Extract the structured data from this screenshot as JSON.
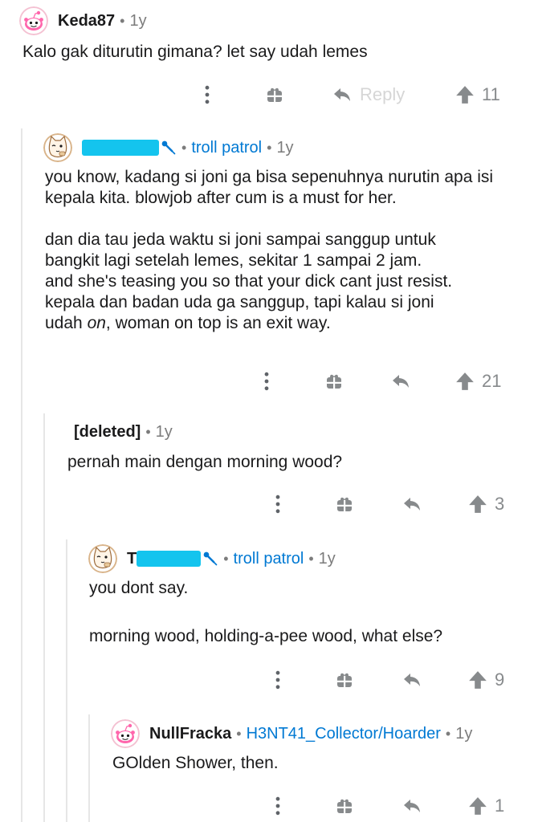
{
  "comments": [
    {
      "username": "Keda87",
      "age": "1y",
      "body": [
        "Kalo gak diturutin gimana? let say udah lemes"
      ],
      "reply_label": "Reply",
      "votes": "11"
    },
    {
      "username_suffix": "",
      "flair": "troll patrol",
      "age": "1y",
      "body_p1": "you know, kadang si joni ga bisa sepenuhnya nurutin apa isi kepala kita. blowjob after cum is a must for her.",
      "body_p2_lines": [
        "dan dia tau jeda waktu si joni sampai sanggup untuk",
        "bangkit lagi setelah lemes, sekitar 1 sampai 2 jam.",
        "and she's teasing you so that your dick cant just resist.",
        "kepala dan badan uda ga sanggup, tapi kalau si joni"
      ],
      "body_p2_last_a": "udah ",
      "body_p2_last_em": "on",
      "body_p2_last_b": ", woman on top is an exit way.",
      "votes": "21"
    },
    {
      "username": "[deleted]",
      "age": "1y",
      "body": [
        "pernah main dengan morning wood?"
      ],
      "votes": "3"
    },
    {
      "username_prefix": "T",
      "flair": "troll patrol",
      "age": "1y",
      "body": [
        "you dont say.",
        "morning wood, holding-a-pee wood, what else?"
      ],
      "votes": "9"
    },
    {
      "username": "NullFracka",
      "flair": "H3NT41_Collector/Hoarder",
      "age": "1y",
      "body": [
        "GOlden Shower, then."
      ],
      "votes": "1"
    }
  ],
  "icons": [
    "more-vertical-icon",
    "award-gift-icon",
    "reply-arrow-icon",
    "upvote-arrow-icon",
    "snoo-avatar",
    "cat-avatar",
    "mic-flair-icon"
  ],
  "colors": {
    "flair": "#0079d3",
    "redaction": "#14c4ee",
    "icon": "#878a8c",
    "thread_line": "#e6e6e6"
  }
}
